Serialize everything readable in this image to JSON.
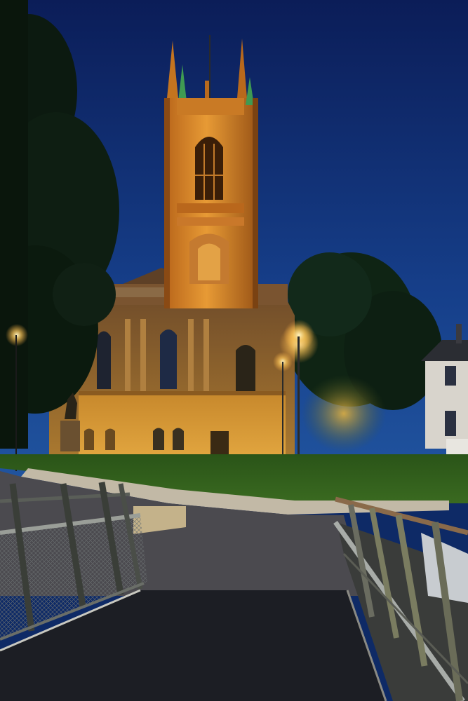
{
  "scene": {
    "colors": {
      "sky_top": "#0c1f5c",
      "sky_bottom": "#1f4f9a",
      "stone_lit": "#d98a2a",
      "stone_mid": "#a8641c",
      "stone_dark": "#5a3410",
      "spire_green": "#3f9a52",
      "lawn": "#2f5a1c",
      "path": "#4a4a4e",
      "bridge_deck": "#1c1f26",
      "railing": "#8a8f8a",
      "tree_dark": "#0d1a10",
      "lamp_glow": "#ffd37a"
    }
  }
}
